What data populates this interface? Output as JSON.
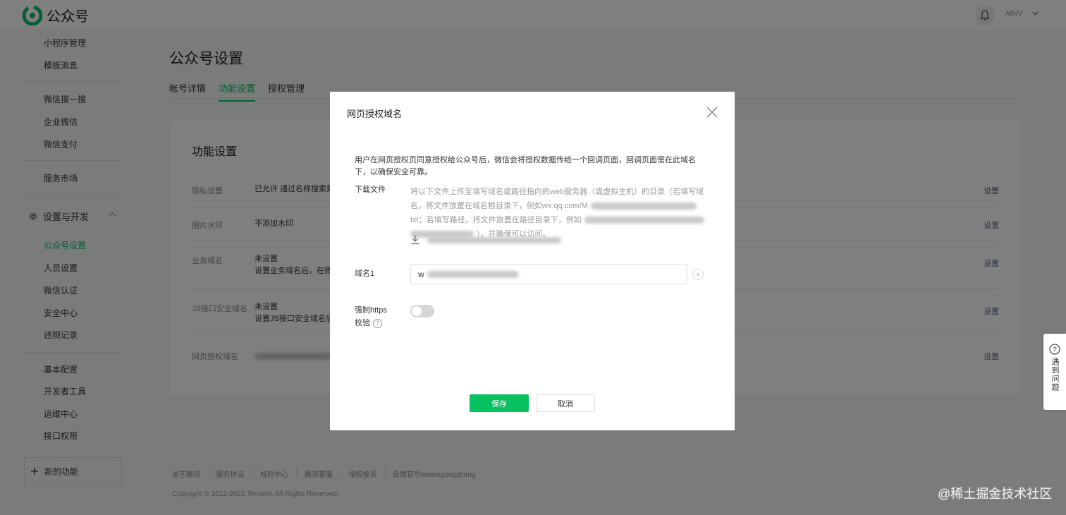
{
  "header": {
    "app_title": "公众号",
    "user_name": "ABVV"
  },
  "sidebar": {
    "items_top": [
      "小程序管理",
      "模板消息"
    ],
    "items_mid": [
      "微信搜一搜",
      "企业微信",
      "微信支付"
    ],
    "items_market": [
      "服务市场"
    ],
    "group_label": "设置与开发",
    "group_items": [
      "公众号设置",
      "人员设置",
      "微信认证",
      "安全中心",
      "违规记录"
    ],
    "items_dev": [
      "基本配置",
      "开发者工具",
      "运维中心",
      "接口权限"
    ],
    "new_feature": "新的功能"
  },
  "main": {
    "page_title": "公众号设置",
    "tabs": [
      "帐号详情",
      "功能设置",
      "授权管理"
    ],
    "panel_title": "功能设置",
    "rows": [
      {
        "label": "隐私设置",
        "value": "已允许 通过名称搜索到",
        "action": "设置"
      },
      {
        "label": "图片水印",
        "value": "不添加水印",
        "action": "设置"
      },
      {
        "label": "业务域名",
        "value": "未设置",
        "value2": "设置业务域名后，在微",
        "action": "设置"
      },
      {
        "label": "JS接口安全域名",
        "value": "未设置",
        "value2": "设置JS接口安全域名后",
        "action": "设置"
      },
      {
        "label": "网页授权域名",
        "value": "",
        "action": "设置"
      }
    ]
  },
  "footer": {
    "links": [
      "关于腾讯",
      "服务协议",
      "规则中心",
      "腾讯客服",
      "侵权投诉",
      "反馈官号weixingongzhong"
    ],
    "copyright": "Copyright © 2012-2022 Tencent. All Rights Reserved.",
    "watermark": "@稀土掘金技术社区"
  },
  "help": {
    "label": "遇到问题"
  },
  "modal": {
    "title": "网页授权域名",
    "description": "用户在网页授权页同意授权给公众号后，微信会将授权数据传给一个回调页面，回调页面需在此域名下，以确保安全可靠。",
    "download_label": "下载文件",
    "download_line1": "将以下文件上传至填写域名或路径指向的web服务器（或虚拟主机）的目录（若填写域",
    "download_line2": "名，将文件放置在域名根目录下，例如wx.qq.com/M",
    "download_line3": "txt；若填写路径，将文件放置在路径目录下，例如",
    "download_line4": "），并确保可以访问。",
    "domain_label": "域名1",
    "domain_value": "w",
    "https_label_1": "强制https",
    "https_label_2": "校验",
    "https_enabled": false,
    "save_label": "保存",
    "cancel_label": "取消"
  },
  "colors": {
    "brand_green": "#07c160",
    "link_blue": "#576b95"
  }
}
